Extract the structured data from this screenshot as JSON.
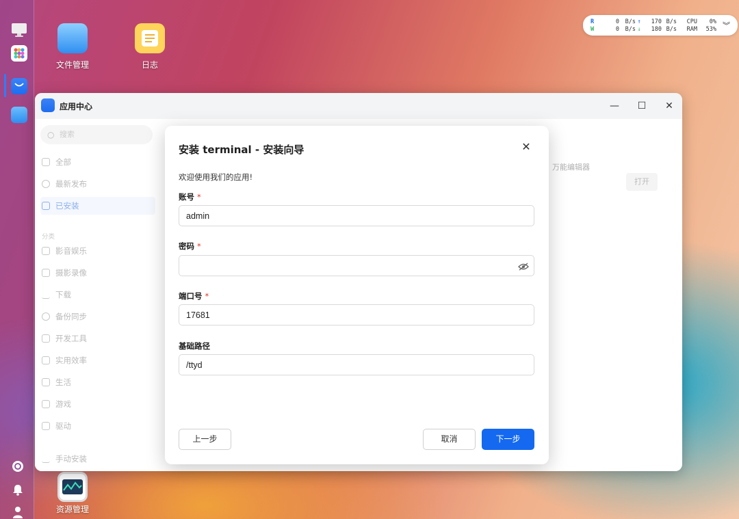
{
  "desktop": {
    "icons": [
      {
        "label": "文件管理"
      },
      {
        "label": "日志"
      },
      {
        "label": "资源管理"
      }
    ]
  },
  "monitor": {
    "read_label": "R",
    "write_label": "W",
    "read_speed": "0",
    "write_speed": "0",
    "unit": "B/s",
    "up_speed": "170",
    "down_speed": "180",
    "cpu_label": "CPU",
    "ram_label": "RAM",
    "cpu_value": "0%",
    "ram_value": "53%"
  },
  "window": {
    "title": "应用中心",
    "search_placeholder": "搜索",
    "nav": [
      {
        "label": "全部"
      },
      {
        "label": "最新发布"
      },
      {
        "label": "已安装"
      }
    ],
    "category_heading": "分类",
    "categories": [
      {
        "label": "影音娱乐"
      },
      {
        "label": "摄影录像"
      },
      {
        "label": "下载"
      },
      {
        "label": "备份同步"
      },
      {
        "label": "开发工具"
      },
      {
        "label": "实用效率"
      },
      {
        "label": "生活"
      },
      {
        "label": "游戏"
      },
      {
        "label": "驱动"
      }
    ],
    "manual_install": "手动安装",
    "content_app_label": "万能编辑器",
    "open_button": "打开"
  },
  "modal": {
    "title": "安装 terminal - 安装向导",
    "welcome": "欢迎使用我们的应用!",
    "fields": {
      "account": {
        "label": "账号",
        "value": "admin"
      },
      "password": {
        "label": "密码",
        "value": ""
      },
      "port": {
        "label": "端口号",
        "value": "17681"
      },
      "base_path": {
        "label": "基础路径",
        "value": "/ttyd"
      }
    },
    "required_mark": "*",
    "prev_button": "上一步",
    "cancel_button": "取消",
    "next_button": "下一步"
  },
  "colors": {
    "primary": "#1469f0",
    "required": "#e0362f"
  }
}
